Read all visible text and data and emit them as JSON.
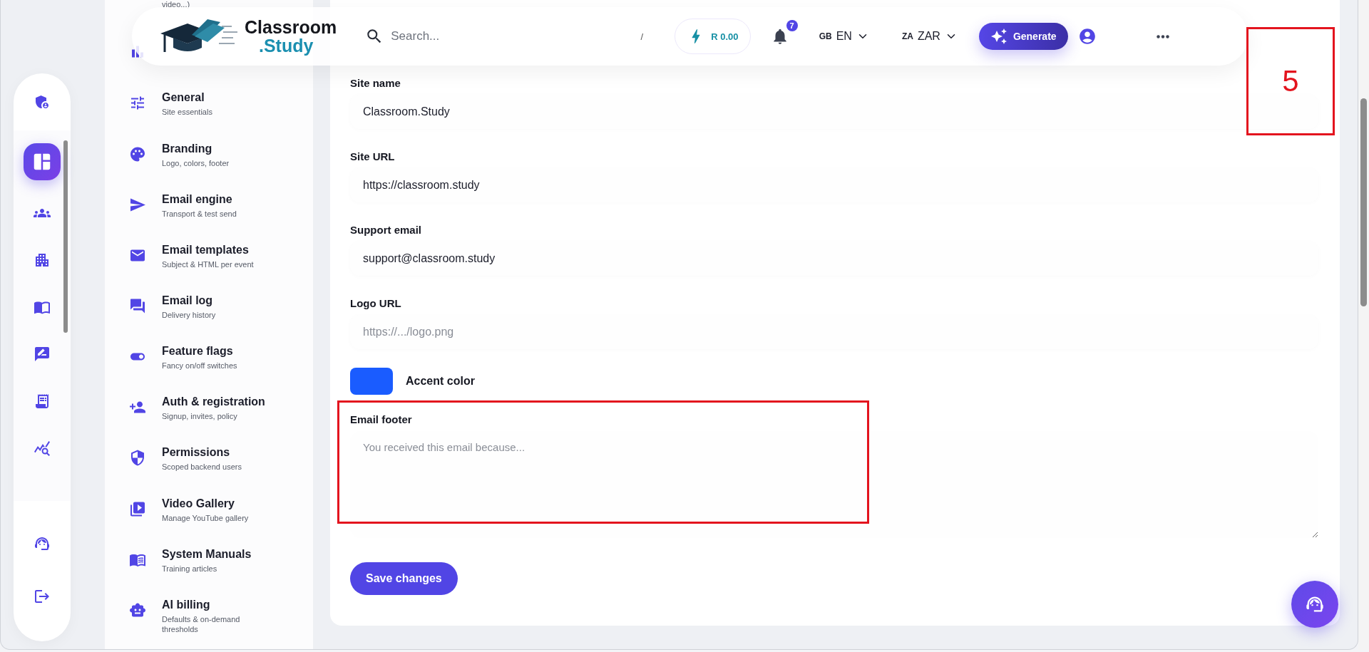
{
  "topbar": {
    "logo": {
      "line1": "Classroom",
      "line2": ".Study"
    },
    "search": {
      "placeholder": "Search...",
      "shortcut": "/"
    },
    "wallet": "R 0.00",
    "notifications": "7",
    "language": {
      "flag": "GB",
      "code": "EN"
    },
    "currency": {
      "flag": "ZA",
      "code": "ZAR"
    },
    "generate": "Generate"
  },
  "rail": [
    {
      "kind": "admin",
      "selected": false
    },
    {
      "kind": "dashboard",
      "selected": true
    },
    {
      "kind": "groups",
      "selected": false
    },
    {
      "kind": "building",
      "selected": false
    },
    {
      "kind": "book",
      "selected": false
    },
    {
      "kind": "review",
      "selected": false
    },
    {
      "kind": "receipt",
      "selected": false
    },
    {
      "kind": "stats",
      "selected": false
    },
    {
      "kind": "support",
      "selected": false
    },
    {
      "kind": "logout",
      "selected": false
    }
  ],
  "sidebar": {
    "partial_item": {
      "text_above": "video...)"
    },
    "items": [
      {
        "kind": "tune",
        "title": "General",
        "subtitle": "Site essentials"
      },
      {
        "kind": "palette",
        "title": "Branding",
        "subtitle": "Logo, colors, footer"
      },
      {
        "kind": "send",
        "title": "Email engine",
        "subtitle": "Transport & test send"
      },
      {
        "kind": "mail",
        "title": "Email templates",
        "subtitle": "Subject & HTML per event"
      },
      {
        "kind": "forum",
        "title": "Email log",
        "subtitle": "Delivery history"
      },
      {
        "kind": "toggle",
        "title": "Feature flags",
        "subtitle": "Fancy on/off switches"
      },
      {
        "kind": "person",
        "title": "Auth & registration",
        "subtitle": "Signup, invites, policy"
      },
      {
        "kind": "shield",
        "title": "Permissions",
        "subtitle": "Scoped backend users"
      },
      {
        "kind": "video",
        "title": "Video Gallery",
        "subtitle": "Manage YouTube gallery"
      },
      {
        "kind": "manual",
        "title": "System Manuals",
        "subtitle": "Training articles"
      },
      {
        "kind": "robot",
        "title": "AI billing",
        "subtitle": "Defaults & on-demand thresholds"
      }
    ]
  },
  "content": {
    "fields": [
      {
        "label": "Site name",
        "value": "Classroom.Study"
      },
      {
        "label": "Site URL",
        "value": "https://classroom.study"
      },
      {
        "label": "Support email",
        "value": "support@classroom.study"
      },
      {
        "label": "Logo URL",
        "placeholder": "https://.../logo.png"
      }
    ],
    "accent": {
      "label": "Accent color",
      "color": "#1a5cff"
    },
    "footer": {
      "label": "Email footer",
      "placeholder": "You received this email because..."
    },
    "save": "Save changes"
  },
  "annotations": [
    {
      "kind": "highlight"
    },
    {
      "kind": "number",
      "label": "5"
    }
  ]
}
